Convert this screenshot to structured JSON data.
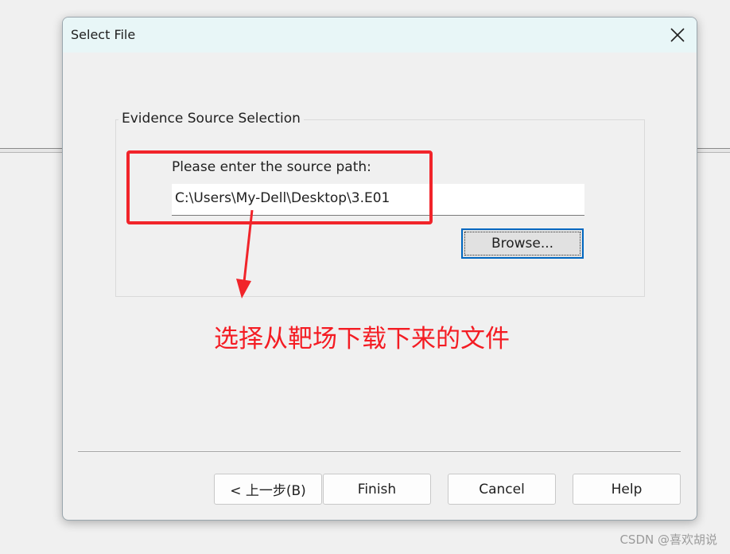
{
  "window": {
    "title": "Select File",
    "close_icon": "close-icon"
  },
  "group": {
    "legend": "Evidence Source Selection",
    "prompt_label": "Please enter the source path:",
    "path_value": "C:\\Users\\My-Dell\\Desktop\\3.E01",
    "browse_label": "Browse..."
  },
  "annotation": {
    "text": "选择从靶场下载下来的文件",
    "color": "#f41c23"
  },
  "buttons": {
    "back": "< 上一步(B)",
    "finish": "Finish",
    "cancel": "Cancel",
    "help": "Help"
  },
  "watermark": "CSDN @喜欢胡说"
}
